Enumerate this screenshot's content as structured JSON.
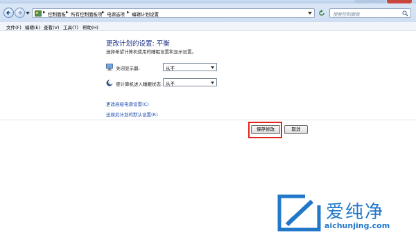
{
  "address_bar": {
    "crumbs": [
      "控制面板",
      "所有控制面板项",
      "电源选项",
      "编辑计划设置"
    ]
  },
  "search": {
    "placeholder": "搜索控制面板"
  },
  "menu": [
    "文件(F)",
    "编辑(E)",
    "查看(V)",
    "工具(T)",
    "帮助(H)"
  ],
  "page": {
    "title": "更改计划的设置: 平衡",
    "subtitle": "选择希望计算机使用的睡眠设置和显示设置。"
  },
  "settings": [
    {
      "label": "关闭显示器:",
      "value": "从不",
      "icon": "monitor-icon"
    },
    {
      "label": "使计算机进入睡眠状态:",
      "value": "从不",
      "icon": "moon-sleep-icon"
    }
  ],
  "links": {
    "advanced": "更改高级电源设置(C)",
    "restore": "还原此计划的默认设置(R)"
  },
  "buttons": {
    "save": "保存修改",
    "cancel": "取消"
  },
  "watermark": {
    "text": "爱纯净",
    "url": "aichunjing.com"
  },
  "colors": {
    "title": "#1e3287",
    "link": "#1f4cab",
    "highlight": "#e0241c",
    "watermark": "#2177c8"
  }
}
